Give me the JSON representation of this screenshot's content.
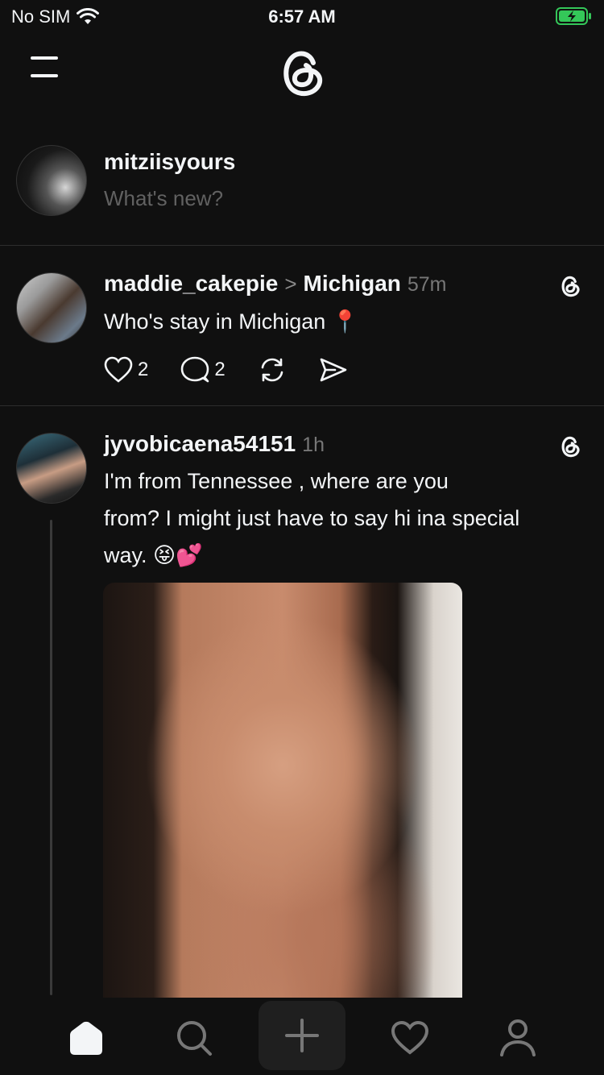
{
  "status": {
    "carrier": "No SIM",
    "time": "6:57 AM"
  },
  "composer": {
    "username": "mitziisyours",
    "placeholder": "What's new?"
  },
  "posts": [
    {
      "username": "maddie_cakepie",
      "separator": ">",
      "topic": "Michigan",
      "time": "57m",
      "text": "Who's stay in Michigan 📍",
      "likes": "2",
      "replies": "2"
    },
    {
      "username": "jyvobicaena54151",
      "time": "1h",
      "text_line1": "I'm from Tennessee , where are you",
      "text_line2": "from? I might just have to say hi ina special",
      "text_line3": "way. 😝💕"
    }
  ],
  "colors": {
    "background": "#101010",
    "text": "#f3f5f7",
    "muted": "#777777",
    "battery": "#34c759"
  },
  "icons": [
    "wifi-icon",
    "battery-icon",
    "menu-icon",
    "threads-logo-icon",
    "heart-icon",
    "comment-icon",
    "repost-icon",
    "share-icon",
    "home-icon",
    "search-icon",
    "plus-icon",
    "activity-heart-icon",
    "profile-icon"
  ]
}
